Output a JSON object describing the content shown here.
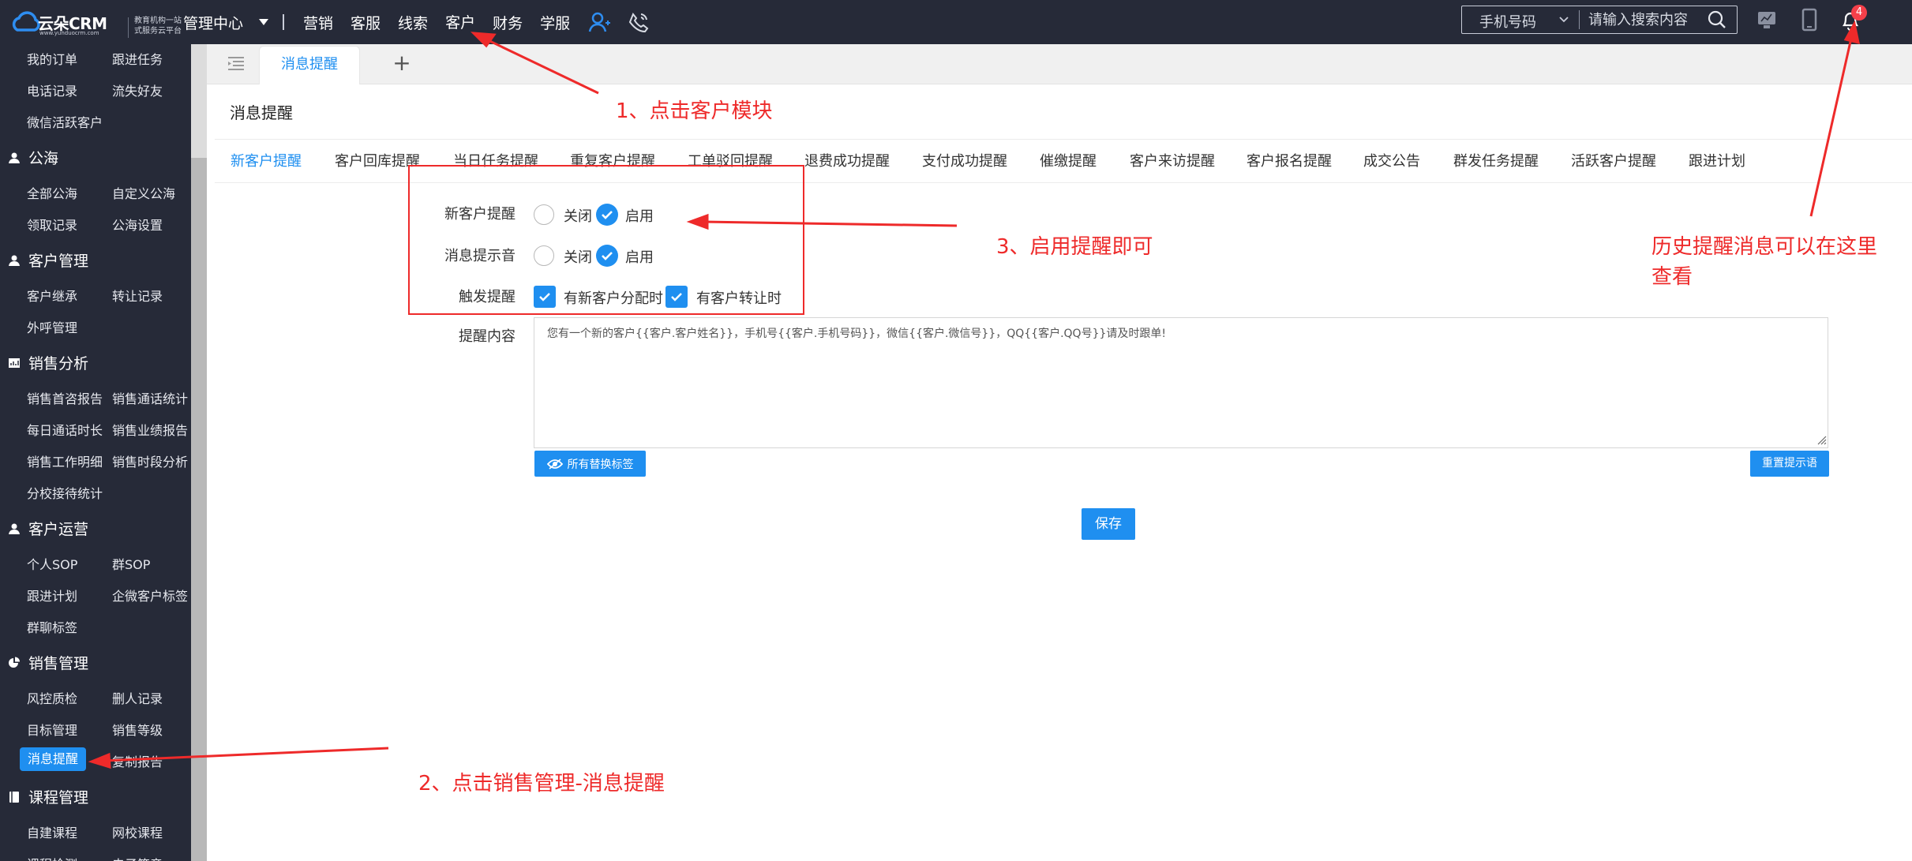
{
  "brand": {
    "name": "云朵CRM",
    "sub": "www.yunduocrm.com",
    "tagline_1": "教育机构一站",
    "tagline_2": "式服务云平台"
  },
  "topnav": {
    "center": "管理中心",
    "items": [
      "营销",
      "客服",
      "线索",
      "客户",
      "财务",
      "学服"
    ],
    "active": "客户"
  },
  "search": {
    "type_label": "手机号码",
    "placeholder": "请输入搜索内容"
  },
  "notifications": {
    "count": "4"
  },
  "sidebar": {
    "rows": [
      {
        "a": "我的订单",
        "b": "跟进任务"
      },
      {
        "a": "电话记录",
        "b": "流失好友"
      },
      {
        "a": "微信活跃客户",
        "b": ""
      }
    ],
    "sections": [
      {
        "title": "公海",
        "icon": "user-icon",
        "rows": [
          {
            "a": "全部公海",
            "b": "自定义公海"
          },
          {
            "a": "领取记录",
            "b": "公海设置"
          }
        ]
      },
      {
        "title": "客户管理",
        "icon": "user-icon",
        "rows": [
          {
            "a": "客户继承",
            "b": "转让记录"
          },
          {
            "a": "外呼管理",
            "b": ""
          }
        ]
      },
      {
        "title": "销售分析",
        "icon": "chart-icon",
        "rows": [
          {
            "a": "销售首咨报告",
            "b": "销售通话统计"
          },
          {
            "a": "每日通话时长",
            "b": "销售业绩报告"
          },
          {
            "a": "销售工作明细",
            "b": "销售时段分析"
          },
          {
            "a": "分校接待统计",
            "b": ""
          }
        ]
      },
      {
        "title": "客户运营",
        "icon": "user-icon",
        "rows": [
          {
            "a": "个人SOP",
            "b": "群SOP"
          },
          {
            "a": "跟进计划",
            "b": "企微客户标签"
          },
          {
            "a": "群聊标签",
            "b": ""
          }
        ]
      },
      {
        "title": "销售管理",
        "icon": "pie-icon",
        "rows": [
          {
            "a": "风控质检",
            "b": "删人记录"
          },
          {
            "a": "目标管理",
            "b": "销售等级"
          },
          {
            "a": "消息提醒",
            "b": "复制报告"
          }
        ]
      },
      {
        "title": "课程管理",
        "icon": "book-icon",
        "rows": [
          {
            "a": "自建课程",
            "b": "网校课程"
          },
          {
            "a": "课程检测",
            "b": "电子签章"
          }
        ]
      }
    ],
    "active_item": "消息提醒"
  },
  "tabs": {
    "active": "消息提醒",
    "add": "+"
  },
  "page": {
    "title": "消息提醒",
    "subtabs": [
      "新客户提醒",
      "客户回库提醒",
      "当日任务提醒",
      "重复客户提醒",
      "工单驳回提醒",
      "退费成功提醒",
      "支付成功提醒",
      "催缴提醒",
      "客户来访提醒",
      "客户报名提醒",
      "成交公告",
      "群发任务提醒",
      "活跃客户提醒",
      "跟进计划"
    ],
    "active_subtab": "新客户提醒"
  },
  "form": {
    "new_customer": {
      "label": "新客户提醒",
      "off": "关闭",
      "on": "启用",
      "value": "启用"
    },
    "sound": {
      "label": "消息提示音",
      "off": "关闭",
      "on": "启用",
      "value": "启用"
    },
    "trigger": {
      "label": "触发提醒",
      "options": [
        "有新客户分配时",
        "有客户转让时"
      ],
      "checked": [
        true,
        true
      ]
    },
    "content": {
      "label": "提醒内容",
      "value": "您有一个新的客户{{客户.客户姓名}}，手机号{{客户.手机号码}}，微信{{客户.微信号}}，QQ{{客户.QQ号}}请及时跟单!"
    },
    "tags_button": "所有替换标签",
    "reset_button": "重置提示语",
    "save_button": "保存"
  },
  "annotations": {
    "step1": "1、点击客户模块",
    "step2": "2、点击销售管理-消息提醒",
    "step3": "3、启用提醒即可",
    "history": "历史提醒消息可以在这里查看"
  },
  "colors": {
    "topbar": "#262a38",
    "accent": "#1f8ff0",
    "annotation": "#ee2a2a",
    "badge": "#f5404a"
  }
}
